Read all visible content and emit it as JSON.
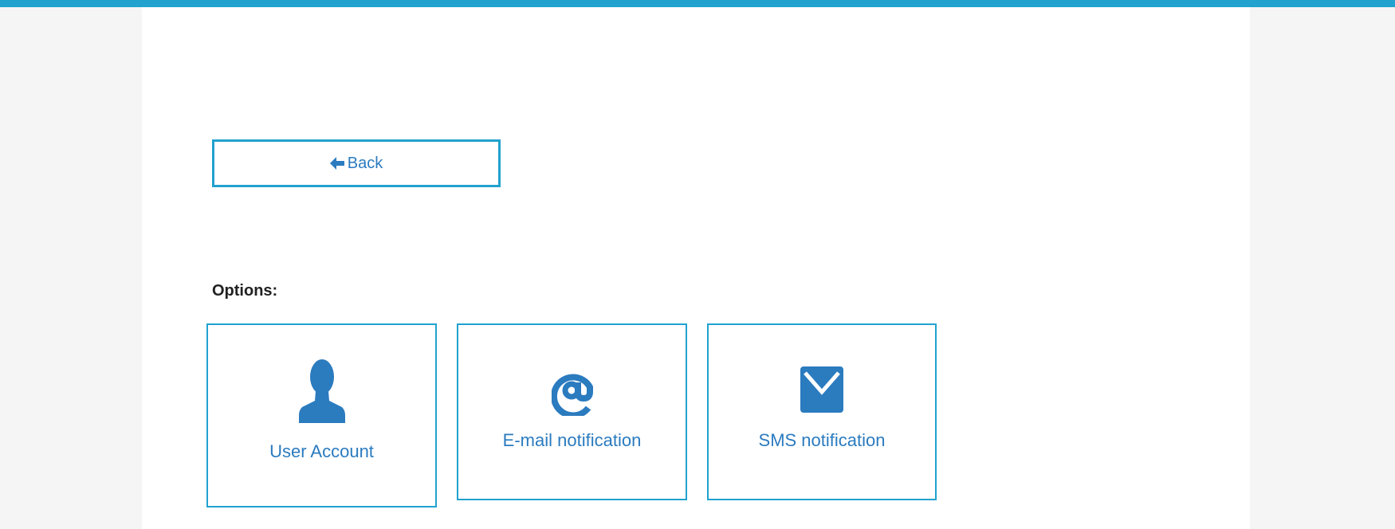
{
  "back_button": {
    "label": "Back",
    "icon": "arrow-left-icon"
  },
  "options": {
    "title": "Options:",
    "items": [
      {
        "label": "User Account",
        "icon": "user-icon"
      },
      {
        "label": "E-mail notification",
        "icon": "at-sign-icon"
      },
      {
        "label": "SMS notification",
        "icon": "envelope-icon"
      }
    ]
  },
  "colors": {
    "accent": "#21a2cf",
    "icon": "#2b7bbf",
    "page_background": "#f5f5f5",
    "panel_background": "#ffffff"
  }
}
